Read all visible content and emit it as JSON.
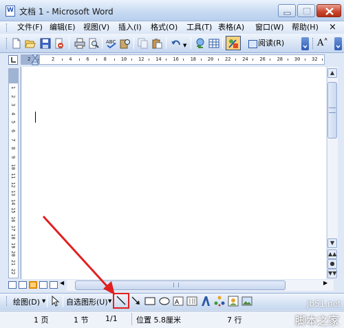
{
  "window": {
    "title": "文档 1 - Microsoft Word",
    "app_icon": "word-doc-icon"
  },
  "menu": {
    "items": [
      "文件(F)",
      "编辑(E)",
      "视图(V)",
      "插入(I)",
      "格式(O)",
      "工具(T)",
      "表格(A)",
      "窗口(W)",
      "帮助(H)"
    ],
    "close_document": "×"
  },
  "toolbar": {
    "read_label": "阅读(R)",
    "font_size_glyph": "A˄",
    "icons": [
      "new-icon",
      "open-icon",
      "save-icon",
      "permission-icon",
      "print-icon",
      "print-preview-icon",
      "spelling-icon",
      "research-icon",
      "copy-icon",
      "paste-icon",
      "undo-icon",
      "insert-hyperlink-icon",
      "table-icon",
      "drawing-icon"
    ]
  },
  "ruler": {
    "horizontal_ticks": [
      "2",
      "2",
      "4",
      "6",
      "8",
      "10",
      "12",
      "14",
      "16",
      "18",
      "20",
      "22",
      "24",
      "26",
      "28",
      "30",
      "32"
    ],
    "vertical_ticks": [
      "1",
      "2",
      "3",
      "4",
      "5",
      "6",
      "7",
      "8",
      "9",
      "10",
      "11",
      "12",
      "13",
      "14",
      "15",
      "16",
      "17",
      "18",
      "19",
      "20",
      "21",
      "22"
    ]
  },
  "drawing_toolbar": {
    "draw_label": "绘图(D)",
    "autoshapes_label": "自选图形(U)",
    "icons": [
      "select-objects-icon",
      "line-icon",
      "arrow-icon",
      "rectangle-icon",
      "oval-icon",
      "textbox-icon",
      "vertical-textbox-icon",
      "wordart-icon",
      "diagram-icon",
      "clipart-icon",
      "picture-icon"
    ]
  },
  "status": {
    "page": "1 页",
    "section": "1 节",
    "page_of": "1/1",
    "position": "位置 5.8厘米",
    "line": "7 行"
  },
  "watermark": {
    "site": "jb51.net",
    "name": "脚本之家"
  },
  "colors": {
    "accent": "#2e5bb6",
    "annotation": "#e21f1f"
  }
}
